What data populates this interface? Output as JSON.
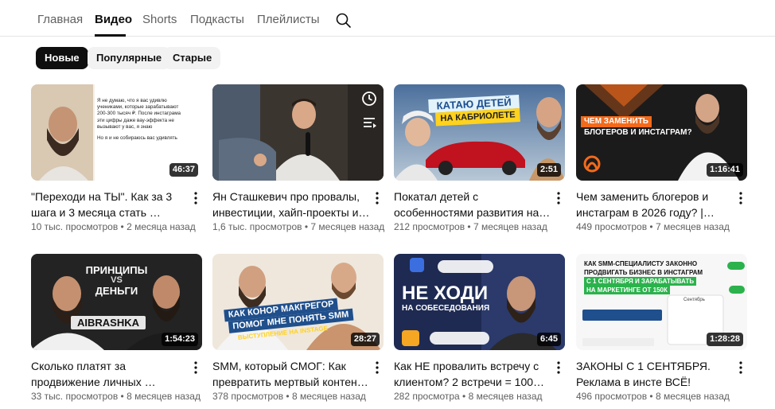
{
  "tabs": [
    {
      "label": "Главная"
    },
    {
      "label": "Видео"
    },
    {
      "label": "Shorts"
    },
    {
      "label": "Подкасты"
    },
    {
      "label": "Плейлисты"
    }
  ],
  "active_tab": "Видео",
  "chips": [
    {
      "label": "Новые"
    },
    {
      "label": "Популярные"
    },
    {
      "label": "Старые"
    }
  ],
  "active_chip": "Новые",
  "videos": [
    {
      "title": "\"Переходи на ТЫ\". Как за 3 шага и 3 месяца стать …",
      "views": "10 тыс. просмотров",
      "age": "2 месяца назад",
      "duration": "46:37",
      "thumb_text": [
        "Я не думаю, что я вас удивлю",
        "учениками, которые зарабатывают",
        "200-300 тысяч ₽. После инстаграма",
        "эти цифры даже вау-эффекта не",
        "вызывают у вас, я знаю",
        "Но я и не собираюсь вас удивлять"
      ]
    },
    {
      "title": "Ян Сташкевич про провалы, инвестиции, хайп-проекты и …",
      "views": "1,6 тыс. просмотров",
      "age": "7 месяцев назад",
      "duration": ""
    },
    {
      "title": "Покатал детей с особенностями развития на …",
      "views": "212 просмотров",
      "age": "7 месяцев назад",
      "duration": "2:51",
      "thumb_text": [
        "КАТАЮ ДЕТЕЙ",
        "НА КАБРИОЛЕТЕ"
      ]
    },
    {
      "title": "Чем заменить блогеров и инстаграм в 2026 году? | Саи…",
      "views": "449 просмотров",
      "age": "7 месяцев назад",
      "duration": "1:16:41",
      "thumb_text": [
        "ЧЕМ ЗАМЕНИТЬ",
        "БЛОГЕРОВ И ИНСТАГРАМ?"
      ]
    },
    {
      "title": "Сколько платят за продвижение личных …",
      "views": "33 тыс. просмотров",
      "age": "8 месяцев назад",
      "duration": "1:54:23",
      "thumb_text": [
        "ПРИНЦИПЫ",
        "VS",
        "ДЕНЬГИ",
        "AIBRASHKA"
      ]
    },
    {
      "title": "SMM, который СМОГ: Как превратить мертвый контен…",
      "views": "378 просмотров",
      "age": "8 месяцев назад",
      "duration": "28:27",
      "thumb_text": [
        "КАК КОНОР МАКГРЕГОР",
        "ПОМОГ МНЕ ПОНЯТЬ SMM",
        "ВЫСТУПЛЕНИЕ НА INSTAGE"
      ]
    },
    {
      "title": "Как НЕ провалить встречу с клиентом? 2 встречи = 100% …",
      "views": "282 просмотра",
      "age": "8 месяцев назад",
      "duration": "6:45",
      "thumb_text": [
        "НЕ ХОДИ",
        "НА СОБЕСЕДОВАНИЯ"
      ]
    },
    {
      "title": "ЗАКОНЫ С 1 СЕНТЯБРЯ. Реклама в инсте ВСЁ!",
      "views": "496 просмотров",
      "age": "8 месяцев назад",
      "duration": "1:28:28",
      "thumb_text": [
        "КАК SMM-СПЕЦИАЛИСТУ ЗАКОННО",
        "ПРОДВИГАТЬ БИЗНЕС В ИНСТАГРАМ",
        "С 1 СЕНТЯБРЯ И ЗАРАБАТЫВАТЬ",
        "НА МАРКЕТИНГЕ ОТ 150К",
        "Сентябрь"
      ]
    }
  ],
  "meta_separator": " • ",
  "colors": {
    "text": "#0f0f0f",
    "secondary": "#606060",
    "chip_bg": "#f2f2f2",
    "accent_orange": "#f26a1b"
  }
}
